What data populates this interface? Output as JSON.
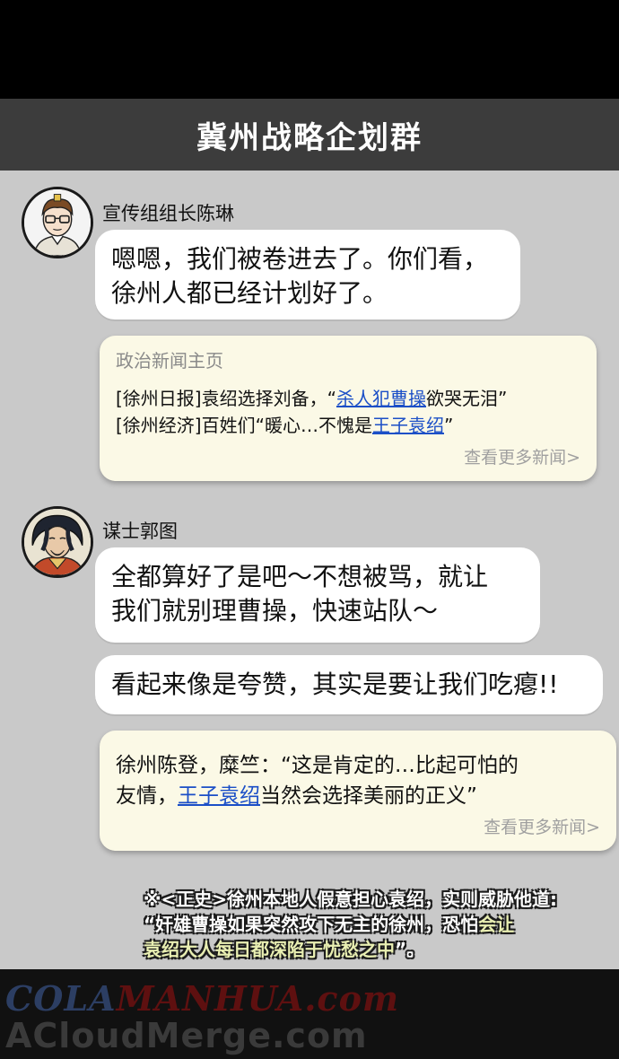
{
  "group": {
    "title": "冀州战略企划群"
  },
  "messages": [
    {
      "sender": "宣传组组长陈琳",
      "lines": [
        "嗯嗯，我们被卷进去了。你们看，",
        "徐州人都已经计划好了。"
      ]
    },
    {
      "sender": "谋士郭图",
      "lines": [
        "全都算好了是吧～不想被骂，就让",
        "我们就别理曹操，快速站队～"
      ],
      "followup": "看起来像是夸赞，其实是要让我们吃瘪!!"
    }
  ],
  "news_card_1": {
    "title": "政治新闻主页",
    "item1": {
      "prefix": "[徐州日报]袁绍选择刘备，“",
      "link": "杀人犯曹操",
      "suffix": "欲哭无泪”"
    },
    "item2": {
      "prefix": "[徐州经济]百姓们“暖心…不愧是",
      "link": "王子袁绍",
      "suffix": "”"
    },
    "more": "查看更多新闻>"
  },
  "news_card_2": {
    "line1": "徐州陈登，糜竺：“这是肯定的…比起可怕的",
    "line2_prefix": "友情，",
    "line2_link": "王子袁绍",
    "line2_suffix": "当然会选择美丽的正义”",
    "more": "查看更多新闻>"
  },
  "footnote": {
    "line1": "※<正史>徐州本地人假意担心袁绍，实则威胁他道:",
    "line2_a": "“奸雄曹操如果突然攻下无主的徐州，恐怕",
    "line2_b": "会让",
    "line3_a": "袁绍大人每日都深陷于忧愁之中",
    "line3_b": "”。"
  },
  "watermark": {
    "line1_a": "COLA",
    "line1_b": "MANHUA.com",
    "line2": "ACloudMerge.com"
  },
  "colors": {
    "header_bg": "#3c3c3c",
    "chat_bg": "#c9c9c9",
    "card_bg": "#fbf9e6",
    "link": "#1b4fc7"
  }
}
